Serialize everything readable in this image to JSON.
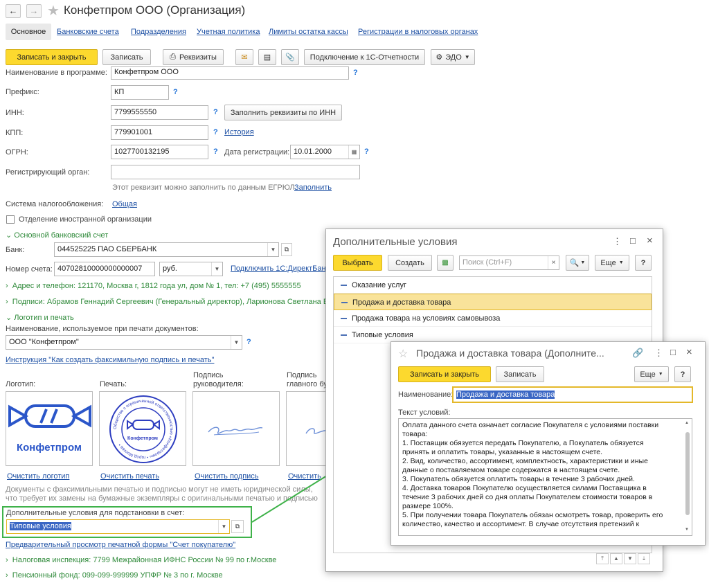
{
  "window": {
    "title": "Конфетпром ООО (Организация)"
  },
  "tabs": [
    "Основное",
    "Банковские счета",
    "Подразделения",
    "Учетная политика",
    "Лимиты остатка кассы",
    "Регистрации в налоговых органах"
  ],
  "toolbar": {
    "save_close": "Записать и закрыть",
    "save": "Записать",
    "requisites": "Реквизиты",
    "connect": "Подключение к 1С-Отчетности",
    "edo": "ЭДО"
  },
  "form": {
    "name_label": "Наименование в программе:",
    "name_value": "Конфетпром ООО",
    "prefix_label": "Префикс:",
    "prefix_value": "КП",
    "inn_label": "ИНН:",
    "inn_value": "7799555550",
    "fill_by_inn": "Заполнить реквизиты по ИНН",
    "kpp_label": "КПП:",
    "kpp_value": "779901001",
    "history": "История",
    "ogrn_label": "ОГРН:",
    "ogrn_value": "1027700132195",
    "regdate_label": "Дата регистрации:",
    "regdate_value": "10.01.2000",
    "regorgan_label": "Регистрирующий орган:",
    "egrul_hint": "Этот реквизит можно заполнить по данным ЕГРЮЛ.",
    "egrul_fill": "Заполнить",
    "tax_label": "Система налогообложения:",
    "tax_value": "Общая",
    "foreign_label": "Отделение иностранной организации",
    "bank_section": "Основной банковский счет",
    "bank_label": "Банк:",
    "bank_value": "044525225 ПАО СБЕРБАНК",
    "account_label": "Номер счета:",
    "account_value": "40702810000000000007",
    "currency": "руб.",
    "direct_bank": "Подключить 1С:ДиректБанк",
    "address_line": "Адрес и телефон: 121170, Москва г, 1812 года ул, дом № 1, тел: +7 (495) 5555555",
    "signatures_line": "Подписи: Абрамов Геннадий Сергеевич (Генеральный директор), Ларионова Светлана Е",
    "logo_section": "Логотип и печать",
    "print_name_label": "Наименование, используемое при печати документов:",
    "print_name_value": "ООО \"Конфетпром\"",
    "instruction_link": "Инструкция \"Как создать факсимильную подпись и печать\"",
    "logo_label": "Логотип:",
    "stamp_label": "Печать:",
    "sign_head_label": "Подпись руководителя:",
    "sign_acc_label": "Подпись главного бу",
    "logo_text": "Конфетпром",
    "stamp_text": "Конфетпром",
    "stamp_ring": "Общество с ограниченной ответственностью «Конфетпром» • город Москва •",
    "clear_logo": "Очистить логотип",
    "clear_stamp": "Очистить печать",
    "clear_sign": "Очистить подпись",
    "clear_sign2": "Очистить",
    "facsimile_note1": "Документы с факсимильными печатью и подписью могут не иметь юридической силы,",
    "facsimile_note2": "что требует их замены на бумажные экземпляры с оригинальными печатью и подписью",
    "addl_label": "Дополнительные условия для подстановки в счет:",
    "addl_value": "Типовые условия",
    "preview_link": "Предварительный просмотр печатной формы \"Счет покупателю\"",
    "tax_office": "Налоговая инспекция: 7799 Межрайонная ИФНС России № 99 по г.Москве",
    "pension": "Пенсионный фонд: 099-099-999999 УПФР № 3 по г. Москве"
  },
  "dialog1": {
    "title": "Дополнительные условия",
    "select": "Выбрать",
    "create": "Создать",
    "search_placeholder": "Поиск (Ctrl+F)",
    "more": "Еще",
    "help": "?",
    "items": [
      "Оказание услуг",
      "Продажа и доставка товара",
      "Продажа товара на условиях самовывоза",
      "Типовые условия"
    ]
  },
  "dialog2": {
    "title": "Продажа и доставка товара (Дополните...",
    "save_close": "Записать и закрыть",
    "save": "Записать",
    "more": "Еще",
    "help": "?",
    "name_label": "Наименование:",
    "name_value": "Продажа и доставка товара",
    "text_label": "Текст условий:",
    "text_lines": [
      "Оплата данного счета означает согласие Покупателя с условиями поставки",
      "товара:",
      "1. Поставщик обязуется передать Покупателю, а Покупатель обязуется",
      "принять и оплатить товары, указанные в настоящем счете.",
      "2. Вид, количество, ассортимент, комплектность, характеристики и иные",
      "данные о поставляемом товаре содержатся в настоящем счете.",
      "3. Покупатель обязуется оплатить товары в течение 3 рабочих дней.",
      "4. Доставка товаров Покупателю осуществляется силами Поставщика в",
      "течение 3 рабочих дней со дня оплаты Покупателем стоимости товаров в",
      "размере 100%.",
      "5. При получении товара Покупатель обязан осмотреть товар, проверить его",
      "количество, качество и ассортимент. В случае отсутствия претензий к"
    ]
  },
  "colors": {
    "accent_yellow": "#fcd92e",
    "link_blue": "#1c4fa3",
    "section_green": "#2f8a3a",
    "highlight_green": "#3fb24a"
  }
}
